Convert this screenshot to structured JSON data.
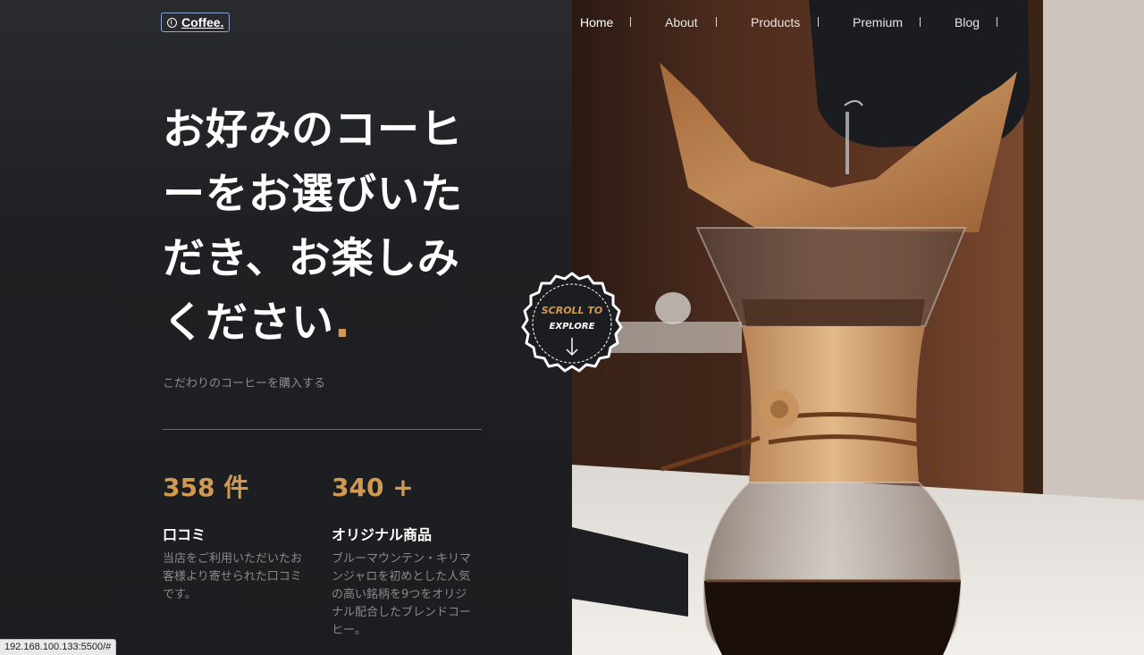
{
  "header": {
    "logo_text": "Coffee.",
    "logo_icon": "coffee-bean-icon",
    "nav": [
      {
        "label": "Home",
        "active": true
      },
      {
        "label": "About",
        "active": false
      },
      {
        "label": "Products",
        "active": false
      },
      {
        "label": "Premium",
        "active": false
      },
      {
        "label": "Blog",
        "active": false
      }
    ]
  },
  "hero": {
    "title": "お好みのコーヒーをお選びいただき、お楽しみください",
    "title_dot": ".",
    "subtitle": "こだわりのコーヒーを購入する"
  },
  "stats": [
    {
      "value": "358 件",
      "label": "口コミ",
      "description": "当店をご利用いただいたお客様より寄せられた口コミです。"
    },
    {
      "value": "340 +",
      "label": "オリジナル商品",
      "description": "ブルーマウンテン・キリマンジャロを初めとした人気の高い銘柄を9つをオリジナル配合したブレンドコーヒー。"
    }
  ],
  "scroll_badge": {
    "line1": "SCROLL TO",
    "line2": "EXPLORE",
    "icon": "arrow-down-icon"
  },
  "status_bar": {
    "url": "192.168.100.133:5500/#"
  },
  "colors": {
    "accent": "#d19a52",
    "background": "#1c1d20",
    "text": "#ffffff",
    "muted": "#8a8a8a"
  },
  "image": {
    "subject": "chemex-coffee-pour-over-photo"
  }
}
